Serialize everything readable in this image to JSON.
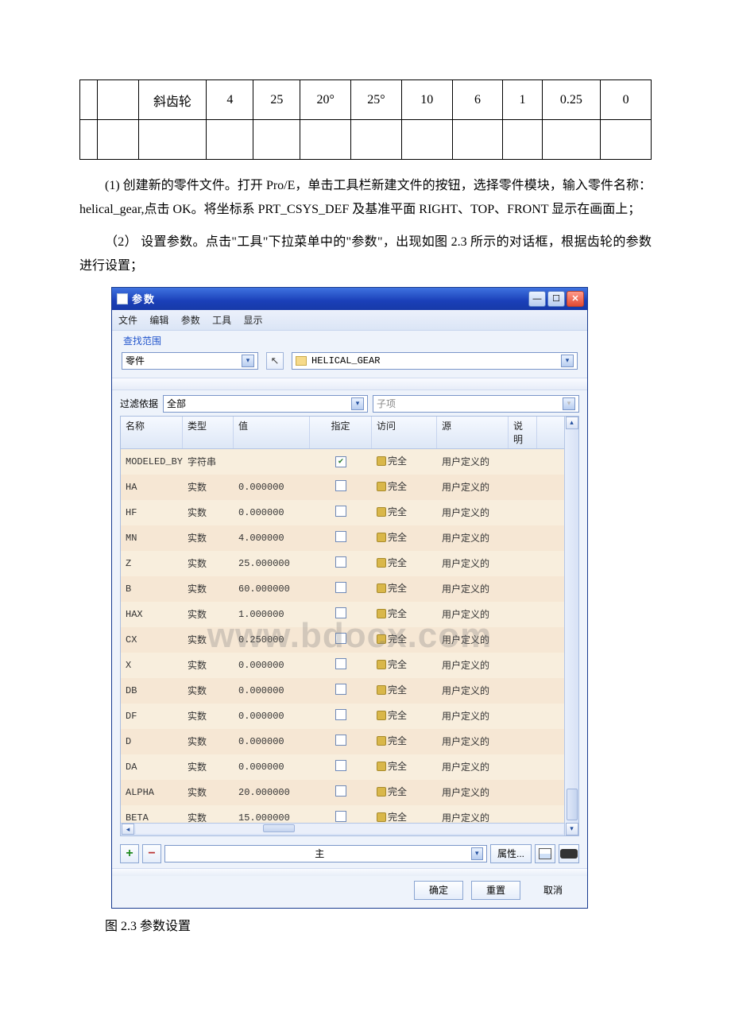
{
  "table": {
    "r1": [
      "斜齿轮",
      "4",
      "25",
      "20°",
      "25°",
      "10",
      "6",
      "1",
      "0.25",
      "0"
    ],
    "r2": [
      "",
      "",
      "",
      "",
      "",
      "",
      "",
      "",
      "",
      ""
    ]
  },
  "para1": "(1) 创建新的零件文件。打开 Pro/E，单击工具栏新建文件的按钮，选择零件模块，输入零件名称：helical_gear,点击 OK。将坐标系 PRT_CSYS_DEF 及基准平面 RIGHT、TOP、FRONT 显示在画面上；",
  "para2": "（2） 设置参数。点击\"工具\"下拉菜单中的\"参数\"，出现如图 2.3 所示的对话框，根据齿轮的参数进行设置；",
  "figcap": "图 2.3  参数设置",
  "dialog": {
    "title": "参数",
    "menus": [
      "文件",
      "编辑",
      "参数",
      "工具",
      "显示"
    ],
    "scopeLabel": "查找范围",
    "scopeCombo": "零件",
    "fileLabel": "HELICAL_GEAR",
    "filterLabel": "过滤依据",
    "filterCombo": "全部",
    "subCombo": "子项",
    "columns": {
      "name": "名称",
      "type": "类型",
      "value": "值",
      "spec": "指定",
      "access": "访问",
      "source": "源",
      "desc": "说明"
    },
    "accessFull": "完全",
    "sourceUser": "用户定义的",
    "rows": [
      {
        "name": "MODELED_BY",
        "type": "字符串",
        "value": "",
        "spec": true
      },
      {
        "name": "HA",
        "type": "实数",
        "value": "0.000000",
        "spec": false
      },
      {
        "name": "HF",
        "type": "实数",
        "value": "0.000000",
        "spec": false
      },
      {
        "name": "MN",
        "type": "实数",
        "value": "4.000000",
        "spec": false
      },
      {
        "name": "Z",
        "type": "实数",
        "value": "25.000000",
        "spec": false
      },
      {
        "name": "B",
        "type": "实数",
        "value": "60.000000",
        "spec": false
      },
      {
        "name": "HAX",
        "type": "实数",
        "value": "1.000000",
        "spec": false
      },
      {
        "name": "CX",
        "type": "实数",
        "value": "0.250000",
        "spec": false
      },
      {
        "name": "X",
        "type": "实数",
        "value": "0.000000",
        "spec": false
      },
      {
        "name": "DB",
        "type": "实数",
        "value": "0.000000",
        "spec": false
      },
      {
        "name": "DF",
        "type": "实数",
        "value": "0.000000",
        "spec": false
      },
      {
        "name": "D",
        "type": "实数",
        "value": "0.000000",
        "spec": false
      },
      {
        "name": "DA",
        "type": "实数",
        "value": "0.000000",
        "spec": false
      },
      {
        "name": "ALPHA",
        "type": "实数",
        "value": "20.000000",
        "spec": false
      },
      {
        "name": "BETA",
        "type": "实数",
        "value": "15.000000",
        "spec": false
      }
    ],
    "mainCombo": "主",
    "propBtn": "属性...",
    "ok": "确定",
    "reset": "重置",
    "cancel": "取消"
  },
  "watermark": "www.bdocx.com"
}
